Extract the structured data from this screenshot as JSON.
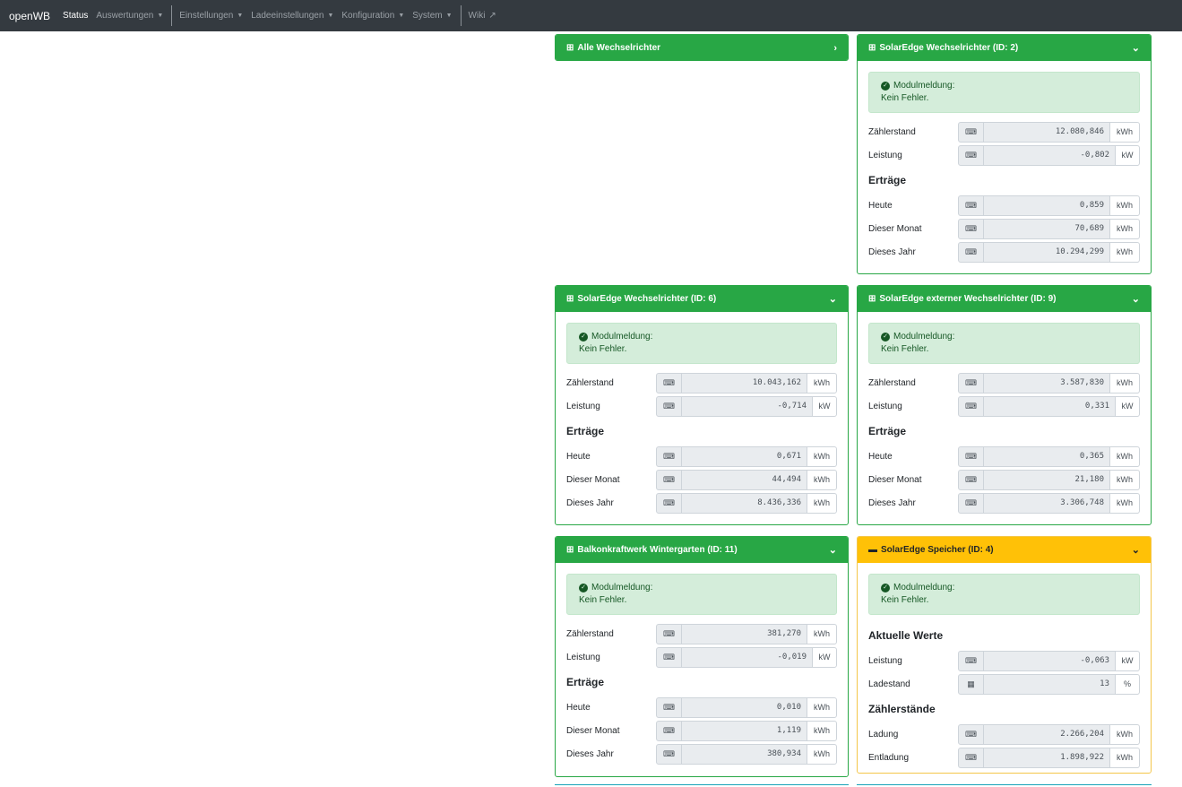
{
  "navbar": {
    "brand": "openWB",
    "items": [
      {
        "label": "Status"
      },
      {
        "label": "Auswertungen"
      },
      {
        "label": "Einstellungen"
      },
      {
        "label": "Ladeeinstellungen"
      },
      {
        "label": "Konfiguration"
      },
      {
        "label": "System"
      },
      {
        "label": "Wiki"
      }
    ]
  },
  "cards": {
    "all": {
      "title": "Alle Wechselrichter"
    },
    "se2": {
      "title": "SolarEdge Wechselrichter (ID: 2)",
      "alert_title": "Modulmeldung:",
      "alert_text": "Kein Fehler.",
      "rows": [
        {
          "label": "Zählerstand",
          "value": "12.080,846",
          "unit": "kWh"
        },
        {
          "label": "Leistung",
          "value": "-0,802",
          "unit": "kW"
        }
      ],
      "section": "Erträge",
      "yield": [
        {
          "label": "Heute",
          "value": "0,859",
          "unit": "kWh"
        },
        {
          "label": "Dieser Monat",
          "value": "70,689",
          "unit": "kWh"
        },
        {
          "label": "Dieses Jahr",
          "value": "10.294,299",
          "unit": "kWh"
        }
      ]
    },
    "se6": {
      "title": "SolarEdge Wechselrichter (ID: 6)",
      "alert_title": "Modulmeldung:",
      "alert_text": "Kein Fehler.",
      "rows": [
        {
          "label": "Zählerstand",
          "value": "10.043,162",
          "unit": "kWh"
        },
        {
          "label": "Leistung",
          "value": "-0,714",
          "unit": "kW"
        }
      ],
      "section": "Erträge",
      "yield": [
        {
          "label": "Heute",
          "value": "0,671",
          "unit": "kWh"
        },
        {
          "label": "Dieser Monat",
          "value": "44,494",
          "unit": "kWh"
        },
        {
          "label": "Dieses Jahr",
          "value": "8.436,336",
          "unit": "kWh"
        }
      ]
    },
    "se9": {
      "title": "SolarEdge externer Wechselrichter (ID: 9)",
      "alert_title": "Modulmeldung:",
      "alert_text": "Kein Fehler.",
      "rows": [
        {
          "label": "Zählerstand",
          "value": "3.587,830",
          "unit": "kWh"
        },
        {
          "label": "Leistung",
          "value": "0,331",
          "unit": "kW"
        }
      ],
      "section": "Erträge",
      "yield": [
        {
          "label": "Heute",
          "value": "0,365",
          "unit": "kWh"
        },
        {
          "label": "Dieser Monat",
          "value": "21,180",
          "unit": "kWh"
        },
        {
          "label": "Dieses Jahr",
          "value": "3.306,748",
          "unit": "kWh"
        }
      ]
    },
    "bk11": {
      "title": "Balkonkraftwerk Wintergarten (ID: 11)",
      "alert_title": "Modulmeldung:",
      "alert_text": "Kein Fehler.",
      "rows": [
        {
          "label": "Zählerstand",
          "value": "381,270",
          "unit": "kWh"
        },
        {
          "label": "Leistung",
          "value": "-0,019",
          "unit": "kW"
        }
      ],
      "section": "Erträge",
      "yield": [
        {
          "label": "Heute",
          "value": "0,010",
          "unit": "kWh"
        },
        {
          "label": "Dieser Monat",
          "value": "1,119",
          "unit": "kWh"
        },
        {
          "label": "Dieses Jahr",
          "value": "380,934",
          "unit": "kWh"
        }
      ]
    },
    "bat4": {
      "title": "SolarEdge Speicher (ID: 4)",
      "alert_title": "Modulmeldung:",
      "alert_text": "Kein Fehler.",
      "section1": "Aktuelle Werte",
      "rows": [
        {
          "label": "Leistung",
          "value": "-0,063",
          "unit": "kW"
        },
        {
          "label": "Ladestand",
          "value": "13",
          "unit": "%"
        }
      ],
      "section2": "Zählerstände",
      "counters": [
        {
          "label": "Ladung",
          "value": "2.266,204",
          "unit": "kWh"
        },
        {
          "label": "Entladung",
          "value": "1.898,922",
          "unit": "kWh"
        }
      ]
    }
  },
  "colors": {
    "navbar": "#343a40",
    "success": "#28a745",
    "warning": "#ffc107",
    "alert_bg": "#d4edda"
  }
}
